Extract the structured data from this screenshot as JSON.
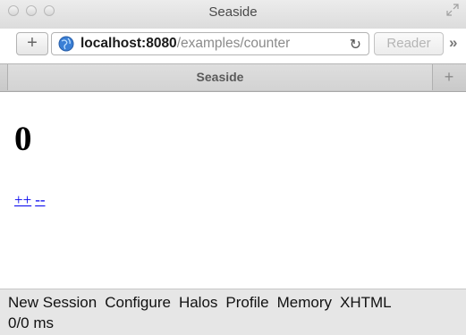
{
  "window": {
    "title": "Seaside"
  },
  "toolbar": {
    "add_label": "+",
    "url_host": "localhost:8080",
    "url_path": "/examples/counter",
    "reload_icon": "reload-icon",
    "reader_label": "Reader",
    "overflow_label": "»"
  },
  "tabs": {
    "active_label": "Seaside",
    "new_tab_label": "+"
  },
  "page": {
    "counter": "0",
    "increment_label": "++",
    "decrement_label": "--"
  },
  "seaside_toolbar": {
    "links": [
      "New Session",
      "Configure",
      "Halos",
      "Profile",
      "Memory",
      "XHTML"
    ],
    "timing": "0/0 ms"
  },
  "colors": {
    "link": "#0000ee",
    "chrome_bg": "#dcdcdc",
    "toolbar_bg": "#e6e6e6"
  }
}
